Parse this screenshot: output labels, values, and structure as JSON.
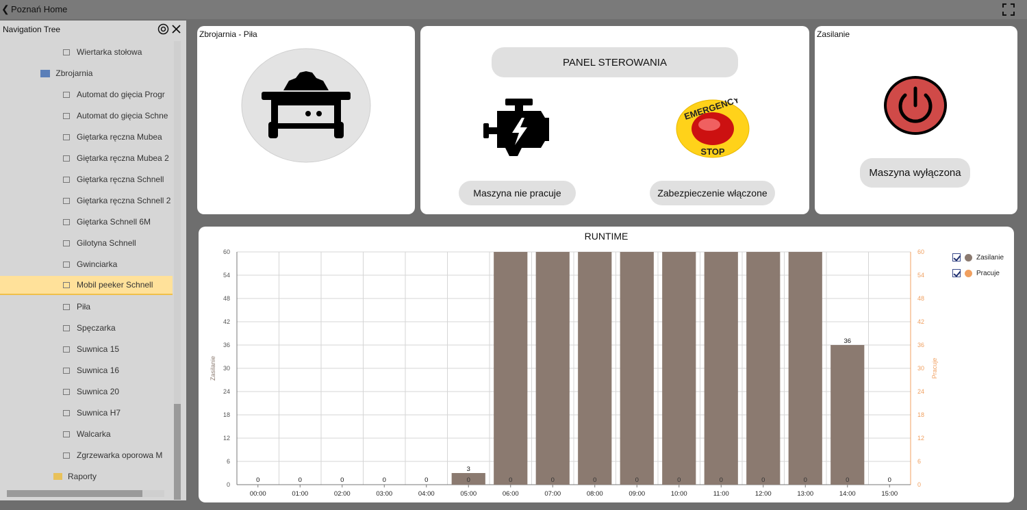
{
  "titlebar": {
    "title": "Poznań Home"
  },
  "sidebar": {
    "header": "Navigation Tree",
    "items": [
      {
        "label": "Wiertarka stołowa",
        "type": "leaf"
      },
      {
        "label": "Zbrojarnia",
        "type": "folder"
      },
      {
        "label": "Automat do gięcia Progr",
        "type": "leaf"
      },
      {
        "label": "Automat do gięcia Schne",
        "type": "leaf"
      },
      {
        "label": "Giętarka ręczna Mubea",
        "type": "leaf"
      },
      {
        "label": "Giętarka ręczna Mubea 2",
        "type": "leaf"
      },
      {
        "label": "Giętarka ręczna Schnell",
        "type": "leaf"
      },
      {
        "label": "Giętarka ręczna Schnell 2",
        "type": "leaf"
      },
      {
        "label": "Giętarka Schnell 6M",
        "type": "leaf"
      },
      {
        "label": "Gilotyna Schnell",
        "type": "leaf"
      },
      {
        "label": "Gwinciarka",
        "type": "leaf"
      },
      {
        "label": "Mobil peeker Schnell",
        "type": "leaf",
        "selected": true
      },
      {
        "label": "Piła",
        "type": "leaf"
      },
      {
        "label": "Spęczarka",
        "type": "leaf"
      },
      {
        "label": "Suwnica 15",
        "type": "leaf"
      },
      {
        "label": "Suwnica 16",
        "type": "leaf"
      },
      {
        "label": "Suwnica 20",
        "type": "leaf"
      },
      {
        "label": "Suwnica H7",
        "type": "leaf"
      },
      {
        "label": "Walcarka",
        "type": "leaf"
      },
      {
        "label": "Zgrzewarka oporowa M",
        "type": "leaf"
      },
      {
        "label": "Raporty",
        "type": "root-folder"
      }
    ]
  },
  "machine_panel": {
    "title": "Zbrojarnia - Piła",
    "icon": "table-saw-icon"
  },
  "control_panel": {
    "header": "PANEL STEROWANIA",
    "engine_status": "Maszyna nie pracuje",
    "safety_status": "Zabezpieczenie włączone",
    "emergency_top": "EMERGENCY",
    "emergency_bottom": "STOP"
  },
  "power_panel": {
    "title": "Zasilanie",
    "status": "Maszyna wyłączona"
  },
  "colors": {
    "zasilanie": "#8b7a70",
    "pracuje": "#f0a060",
    "power_button": "#d04a48"
  },
  "chart_data": {
    "type": "bar",
    "title": "RUNTIME",
    "categories": [
      "00:00",
      "01:00",
      "02:00",
      "03:00",
      "04:00",
      "05:00",
      "06:00",
      "07:00",
      "08:00",
      "09:00",
      "10:00",
      "11:00",
      "12:00",
      "13:00",
      "14:00",
      "15:00"
    ],
    "series": [
      {
        "name": "Zasilanie",
        "values": [
          0,
          0,
          0,
          0,
          0,
          3,
          60,
          60,
          60,
          60,
          60,
          60,
          60,
          60,
          36,
          0
        ]
      },
      {
        "name": "Pracuje",
        "values": [
          0,
          0,
          0,
          0,
          0,
          0,
          0,
          0,
          0,
          0,
          0,
          0,
          0,
          0,
          0,
          0
        ]
      }
    ],
    "bar_labels": [
      "0",
      "0",
      "0",
      "0",
      "0",
      "3",
      "",
      "",
      "",
      "",
      "",
      "",
      "",
      "",
      "36",
      "0"
    ],
    "inner_labels": [
      "",
      "",
      "",
      "",
      "",
      "0",
      "0",
      "0",
      "0",
      "0",
      "0",
      "0",
      "0",
      "0",
      "0",
      ""
    ],
    "ylabel": "Zasilanie",
    "y2label": "Pracuje",
    "ylim": [
      0,
      60
    ],
    "yticks": [
      "0",
      "6",
      "12",
      "18",
      "24",
      "30",
      "36",
      "42",
      "48",
      "54",
      "60"
    ],
    "grid": true,
    "legend": "top-right"
  }
}
